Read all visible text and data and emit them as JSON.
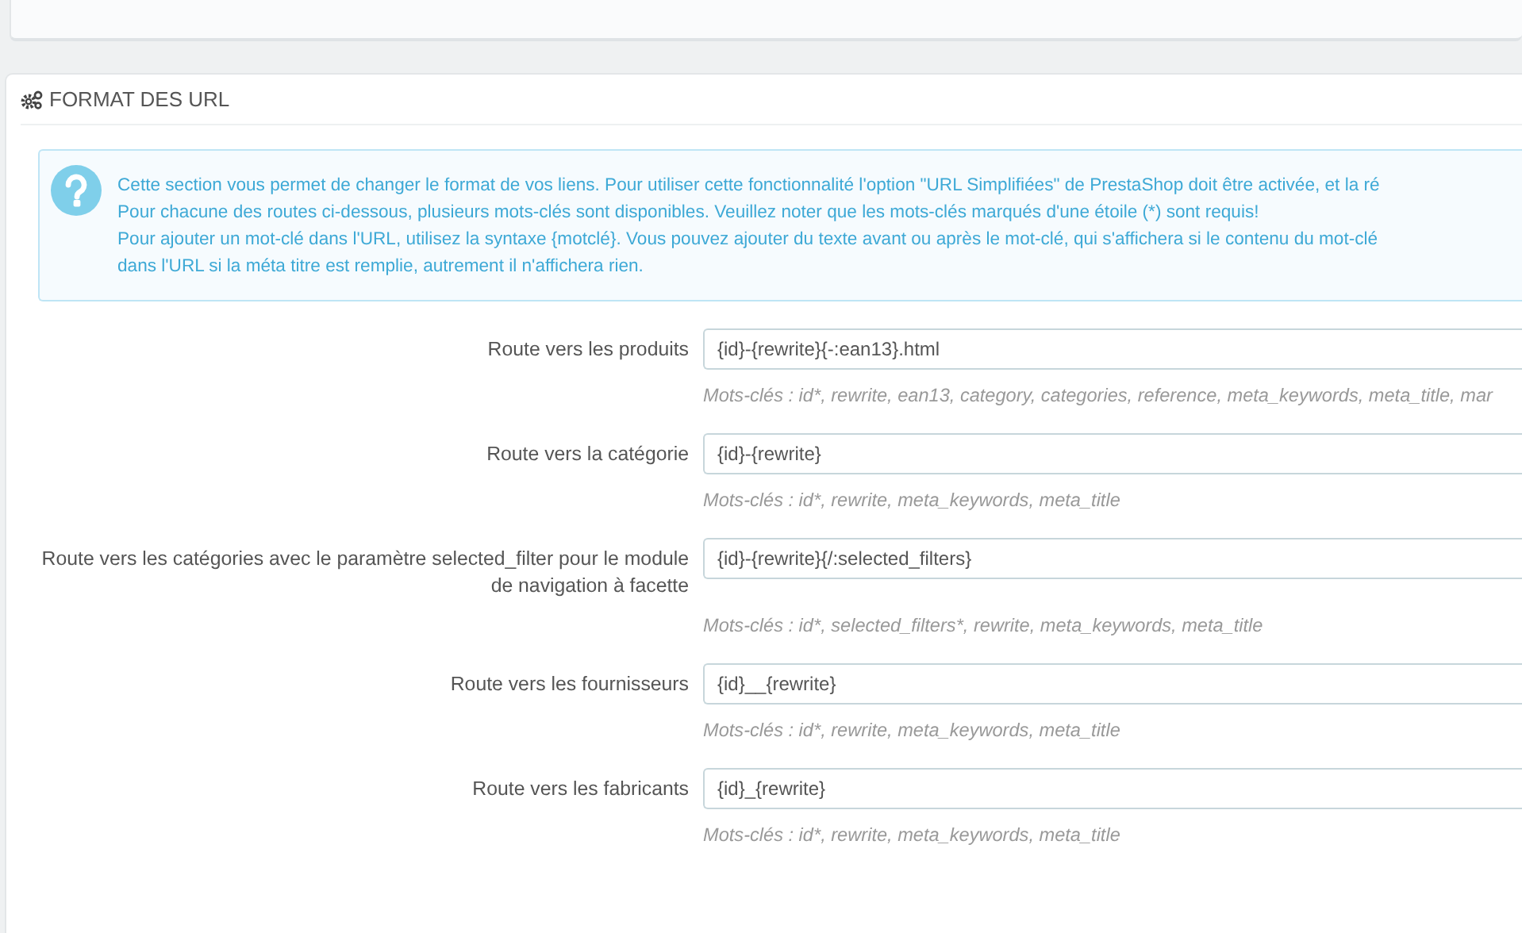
{
  "panel": {
    "title": "FORMAT DES URL"
  },
  "info": {
    "lines": [
      "Cette section vous permet de changer le format de vos liens. Pour utiliser cette fonctionnalité l'option \"URL Simplifiées\" de PrestaShop doit être activée, et la ré",
      "Pour chacune des routes ci-dessous, plusieurs mots-clés sont disponibles. Veuillez noter que les mots-clés marqués d'une étoile (*) sont requis!",
      "Pour ajouter un mot-clé dans l'URL, utilisez la syntaxe {motclé}. Vous pouvez ajouter du texte avant ou après le mot-clé, qui s'affichera si le contenu du mot-clé",
      "dans l'URL si la méta titre est remplie, autrement il n'affichera rien."
    ]
  },
  "routes": [
    {
      "label": "Route vers les produits",
      "value": "{id}-{rewrite}{-:ean13}.html",
      "help": "Mots-clés : id*, rewrite, ean13, category, categories, reference, meta_keywords, meta_title, mar"
    },
    {
      "label": "Route vers la catégorie",
      "value": "{id}-{rewrite}",
      "help": "Mots-clés : id*, rewrite, meta_keywords, meta_title"
    },
    {
      "label": "Route vers les catégories avec le paramètre selected_filter pour le module de navigation à facette",
      "value": "{id}-{rewrite}{/:selected_filters}",
      "help": "Mots-clés : id*, selected_filters*, rewrite, meta_keywords, meta_title"
    },
    {
      "label": "Route vers les fournisseurs",
      "value": "{id}__{rewrite}",
      "help": "Mots-clés : id*, rewrite, meta_keywords, meta_title"
    },
    {
      "label": "Route vers les fabricants",
      "value": "{id}_{rewrite}",
      "help": "Mots-clés : id*, rewrite, meta_keywords, meta_title"
    }
  ]
}
